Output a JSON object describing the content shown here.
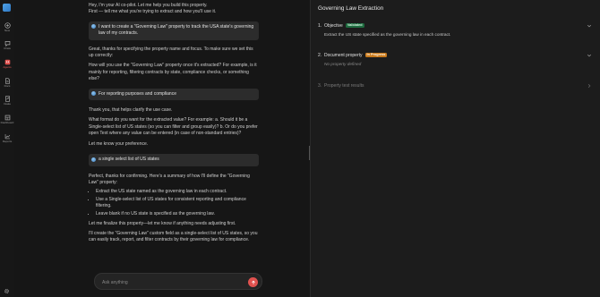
{
  "nav": {
    "items": [
      {
        "label": "New",
        "icon": "plus-circle-icon",
        "active": false
      },
      {
        "label": "Chats",
        "icon": "chat-bubble-icon",
        "active": false
      },
      {
        "label": "Agents",
        "icon": "agent-icon",
        "active": true
      },
      {
        "label": "Docs",
        "icon": "document-icon",
        "active": false
      },
      {
        "label": "Intake",
        "icon": "intake-icon",
        "active": false
      },
      {
        "label": "Dashboard",
        "icon": "dashboard-icon",
        "active": false
      },
      {
        "label": "Reports",
        "icon": "chart-icon",
        "active": false
      }
    ],
    "settings_icon": "gear-icon"
  },
  "chat": {
    "m1a": "Hey, I'm your AI co-pilot. Let me help you build this property.",
    "m1b": "First — tell me what you're trying to extract and how you'll use it.",
    "u1": "I want to create a \"Governing Law\" property to track the USA state's governing law of my contracts.",
    "m2a": "Great, thanks for specifying the property name and focus. To make sure we set this up correctly:",
    "m2b": "How will you use the \"Governing Law\" property once it's extracted? For example, is it mainly for reporting, filtering contracts by state, compliance checks, or something else?",
    "u2": "For reporting purposes and compliance",
    "m3a": "Thank you, that helps clarify the use case.",
    "m3b": "What format do you want for the extracted value? For example: a. Should it be a Single-select list of US states (so you can filter and group easily)? b. Or do you prefer open Text where any value can be entered (in case of non-standard entries)?",
    "m3c": "Let me know your preference.",
    "u3": "a single select list of US states",
    "m4a": "Perfect, thanks for confirming. Here's a summary of how I'll define the \"Governing Law\" property:",
    "bullets": [
      "Extract the US state named as the governing law in each contract.",
      "Use a Single-select list of US states for consistent reporting and compliance filtering.",
      "Leave blank if no US state is specified as the governing law."
    ],
    "m4b": "Let me finalize this property—let me know if anything needs adjusting first.",
    "m5": "I'll create the \"Governing Law\" custom field as a single-select list of US states, so you can easily track, report, and filter contracts by their governing law for compliance."
  },
  "composer": {
    "placeholder": "Ask anything"
  },
  "panel": {
    "title": "Governing Law Extraction",
    "steps": [
      {
        "num": "1.",
        "title": "Objective",
        "badge": "Validated",
        "body": "Extract the US state specified as the governing law in each contract."
      },
      {
        "num": "2.",
        "title": "Document property",
        "badge": "In Progress",
        "body": "No property defined"
      },
      {
        "num": "3.",
        "title": "Property test results"
      }
    ]
  },
  "colors": {
    "accent": "#e0524f",
    "validated": "#1e6b3f",
    "in_progress": "#c8791b"
  }
}
